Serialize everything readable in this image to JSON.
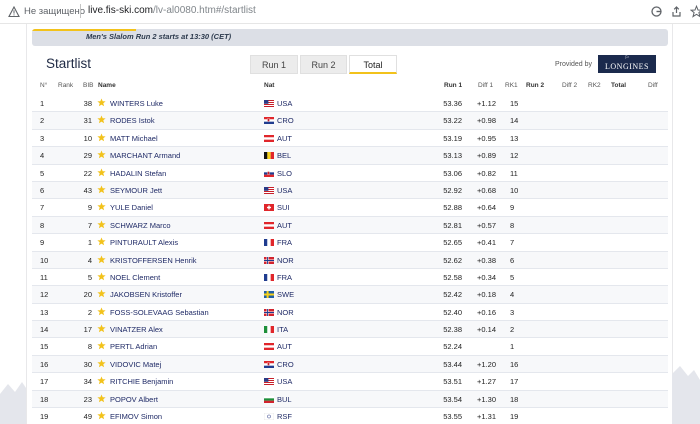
{
  "browser": {
    "insecure_label": "Не защищено",
    "url_host": "live.fis-ski.com",
    "url_path": "/lv-al0080.htm#/startlist"
  },
  "banner": {
    "text": "Men's Slalom Run 2 starts at 13:30 (CET)"
  },
  "title": "Startlist",
  "tabs": [
    {
      "label": "Run 1",
      "active": false
    },
    {
      "label": "Run 2",
      "active": false
    },
    {
      "label": "Total",
      "active": true
    }
  ],
  "sponsor": {
    "provided_by": "Provided by",
    "brand": "LONGINES"
  },
  "columns": {
    "no": "N°",
    "rank": "Rank",
    "bib": "BIB",
    "name": "Name",
    "nat": "Nat",
    "run1": "Run 1",
    "diff1": "Diff 1",
    "rk1": "RK1",
    "run2": "Run 2",
    "diff2": "Diff 2",
    "rk2": "RK2",
    "total": "Total",
    "diff": "Diff"
  },
  "colors": {
    "accent": "#f2c21b",
    "navy": "#1f2a66",
    "banner": "#dcdfe6"
  },
  "rows": [
    {
      "no": "1",
      "bib": "38",
      "name": "WINTERS Luke",
      "nat": "USA",
      "run1": "53.36",
      "diff1": "+1.12",
      "rk1": "15"
    },
    {
      "no": "2",
      "bib": "31",
      "name": "RODES Istok",
      "nat": "CRO",
      "run1": "53.22",
      "diff1": "+0.98",
      "rk1": "14"
    },
    {
      "no": "3",
      "bib": "10",
      "name": "MATT Michael",
      "nat": "AUT",
      "run1": "53.19",
      "diff1": "+0.95",
      "rk1": "13"
    },
    {
      "no": "4",
      "bib": "29",
      "name": "MARCHANT Armand",
      "nat": "BEL",
      "run1": "53.13",
      "diff1": "+0.89",
      "rk1": "12"
    },
    {
      "no": "5",
      "bib": "22",
      "name": "HADALIN Stefan",
      "nat": "SLO",
      "run1": "53.06",
      "diff1": "+0.82",
      "rk1": "11"
    },
    {
      "no": "6",
      "bib": "43",
      "name": "SEYMOUR Jett",
      "nat": "USA",
      "run1": "52.92",
      "diff1": "+0.68",
      "rk1": "10"
    },
    {
      "no": "7",
      "bib": "9",
      "name": "YULE Daniel",
      "nat": "SUI",
      "run1": "52.88",
      "diff1": "+0.64",
      "rk1": "9"
    },
    {
      "no": "8",
      "bib": "7",
      "name": "SCHWARZ Marco",
      "nat": "AUT",
      "run1": "52.81",
      "diff1": "+0.57",
      "rk1": "8"
    },
    {
      "no": "9",
      "bib": "1",
      "name": "PINTURAULT Alexis",
      "nat": "FRA",
      "run1": "52.65",
      "diff1": "+0.41",
      "rk1": "7"
    },
    {
      "no": "10",
      "bib": "4",
      "name": "KRISTOFFERSEN Henrik",
      "nat": "NOR",
      "run1": "52.62",
      "diff1": "+0.38",
      "rk1": "6"
    },
    {
      "no": "11",
      "bib": "5",
      "name": "NOEL Clement",
      "nat": "FRA",
      "run1": "52.58",
      "diff1": "+0.34",
      "rk1": "5"
    },
    {
      "no": "12",
      "bib": "20",
      "name": "JAKOBSEN Kristoffer",
      "nat": "SWE",
      "run1": "52.42",
      "diff1": "+0.18",
      "rk1": "4"
    },
    {
      "no": "13",
      "bib": "2",
      "name": "FOSS-SOLEVAAG Sebastian",
      "nat": "NOR",
      "run1": "52.40",
      "diff1": "+0.16",
      "rk1": "3"
    },
    {
      "no": "14",
      "bib": "17",
      "name": "VINATZER Alex",
      "nat": "ITA",
      "run1": "52.38",
      "diff1": "+0.14",
      "rk1": "2"
    },
    {
      "no": "15",
      "bib": "8",
      "name": "PERTL Adrian",
      "nat": "AUT",
      "run1": "52.24",
      "diff1": "",
      "rk1": "1"
    },
    {
      "no": "16",
      "bib": "30",
      "name": "VIDOVIC Matej",
      "nat": "CRO",
      "run1": "53.44",
      "diff1": "+1.20",
      "rk1": "16"
    },
    {
      "no": "17",
      "bib": "34",
      "name": "RITCHIE Benjamin",
      "nat": "USA",
      "run1": "53.51",
      "diff1": "+1.27",
      "rk1": "17"
    },
    {
      "no": "18",
      "bib": "23",
      "name": "POPOV Albert",
      "nat": "BUL",
      "run1": "53.54",
      "diff1": "+1.30",
      "rk1": "18"
    },
    {
      "no": "19",
      "bib": "49",
      "name": "EFIMOV Simon",
      "nat": "RSF",
      "run1": "53.55",
      "diff1": "+1.31",
      "rk1": "19"
    }
  ]
}
